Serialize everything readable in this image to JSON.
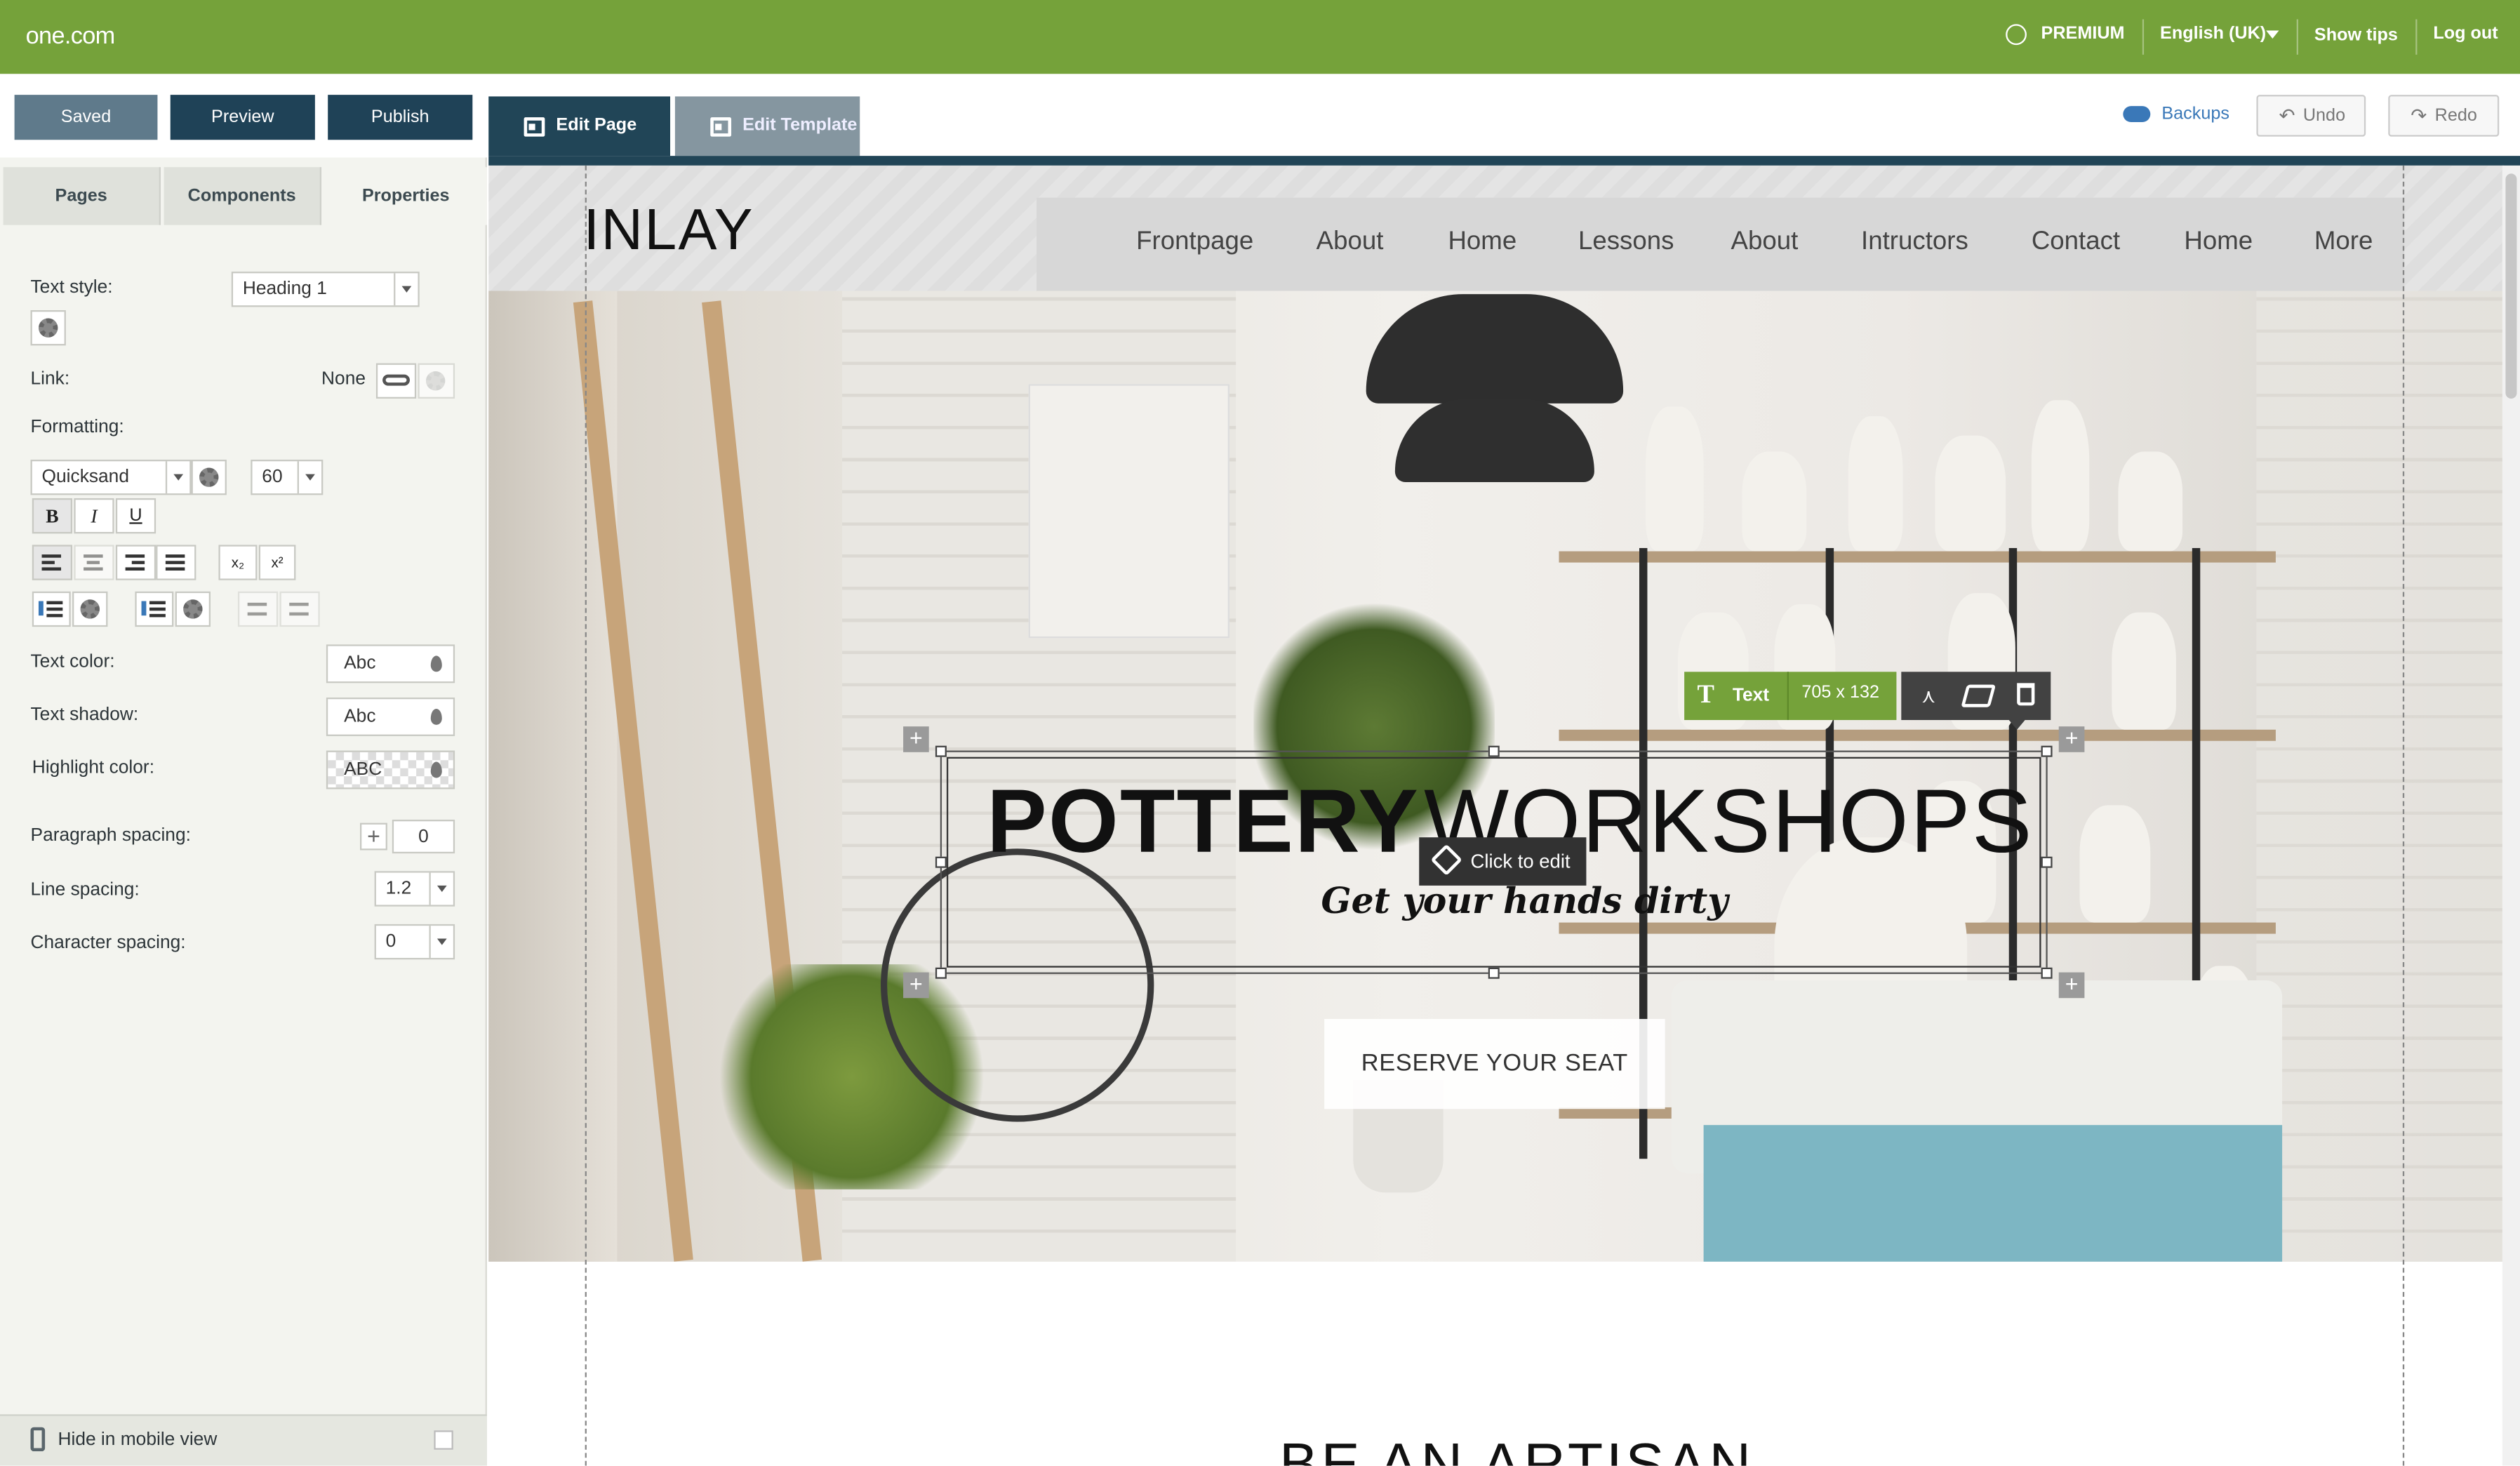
{
  "topbar": {
    "logo": "one.com",
    "premium": "PREMIUM",
    "language": "English (UK)",
    "show_tips": "Show tips",
    "logout": "Log out"
  },
  "toolbar": {
    "saved": "Saved",
    "preview": "Preview",
    "publish": "Publish",
    "edit_page": "Edit Page",
    "edit_template": "Edit Template",
    "backups": "Backups",
    "undo": "Undo",
    "redo": "Redo"
  },
  "panel": {
    "tabs": [
      "Pages",
      "Components",
      "Properties"
    ],
    "text_style_label": "Text style:",
    "text_style_value": "Heading 1",
    "link_label": "Link:",
    "link_value": "None",
    "formatting_label": "Formatting:",
    "font_value": "Quicksand",
    "font_size": "60",
    "bold": "B",
    "italic": "I",
    "underline": "U",
    "subscript": "x₂",
    "superscript": "x²",
    "text_color_label": "Text color:",
    "text_color_value": "Abc",
    "text_shadow_label": "Text shadow:",
    "text_shadow_value": "Abc",
    "highlight_label": "Highlight color:",
    "highlight_value": "ABC",
    "paragraph_label": "Paragraph spacing:",
    "paragraph_value": "0",
    "line_label": "Line spacing:",
    "line_value": "1.2",
    "char_label": "Character spacing:",
    "char_value": "0",
    "mobile_label": "Hide in mobile view"
  },
  "site": {
    "logo": "INLAY",
    "nav": [
      "Frontpage",
      "About",
      "Home",
      "Lessons",
      "About",
      "Intructors",
      "Contact",
      "Home",
      "More"
    ],
    "title_bold": "POTTERY",
    "title_light": "WORKSHOPS",
    "subtitle": "Get your hands dirty",
    "cta": "RESERVE YOUR SEAT",
    "below_heading": "BE AN ARTISAN"
  },
  "element_toolbar": {
    "type": "Text",
    "size": "705 x 132",
    "click_to_edit": "Click to edit"
  },
  "colors": {
    "brand_green": "#75a23a",
    "navy": "#1f4257",
    "link_blue": "#3a78b8"
  }
}
